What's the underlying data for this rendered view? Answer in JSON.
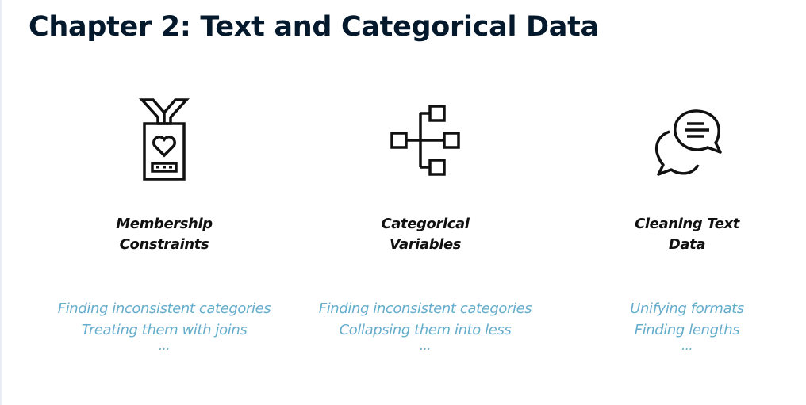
{
  "page": {
    "title": "Chapter 2: Text and Categorical Data"
  },
  "colors": {
    "title": "#05192d",
    "topic_name": "#111111",
    "details": "#65adcb"
  },
  "topics": [
    {
      "icon": "membership-badge-icon",
      "name_lines": [
        "Membership",
        "Constraints"
      ],
      "details": [
        "Finding inconsistent categories",
        "Treating them with joins",
        "..."
      ]
    },
    {
      "icon": "hierarchy-tree-icon",
      "name_lines": [
        "Categorical",
        "Variables"
      ],
      "details": [
        "Finding inconsistent categories",
        "Collapsing them into less",
        "..."
      ]
    },
    {
      "icon": "chat-bubbles-icon",
      "name_lines": [
        "Cleaning Text",
        "Data"
      ],
      "details": [
        "Unifying formats",
        "Finding lengths",
        "..."
      ]
    }
  ]
}
